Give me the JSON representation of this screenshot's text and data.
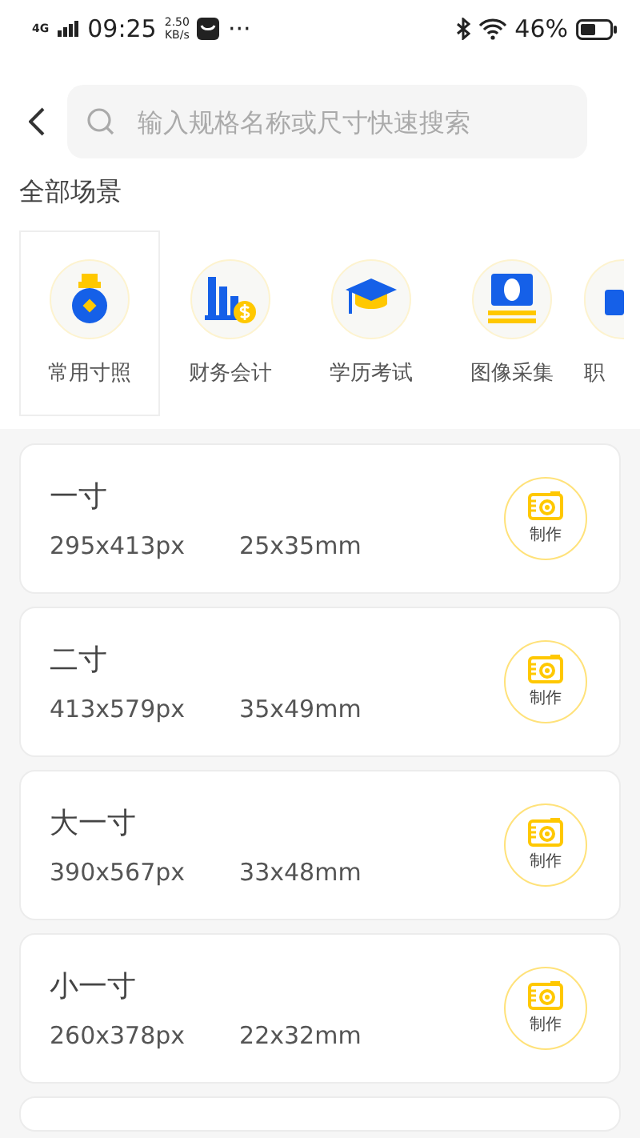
{
  "status_bar": {
    "network": "4G",
    "time": "09:25",
    "speed_value": "2.50",
    "speed_unit": "KB/s",
    "more": "···",
    "battery": "46%"
  },
  "search": {
    "placeholder": "输入规格名称或尺寸快速搜索"
  },
  "section_title": "全部场景",
  "categories": [
    {
      "label": "常用寸照",
      "kind": "medal",
      "selected": true
    },
    {
      "label": "财务会计",
      "kind": "finance",
      "selected": false
    },
    {
      "label": "学历考试",
      "kind": "graduation",
      "selected": false
    },
    {
      "label": "图像采集",
      "kind": "portrait",
      "selected": false
    },
    {
      "label": "职",
      "kind": "case",
      "selected": false
    }
  ],
  "specs": [
    {
      "title": "一寸",
      "pixels": "295x413px",
      "size": "25x35mm",
      "button": "制作"
    },
    {
      "title": "二寸",
      "pixels": "413x579px",
      "size": "35x49mm",
      "button": "制作"
    },
    {
      "title": "大一寸",
      "pixels": "390x567px",
      "size": "33x48mm",
      "button": "制作"
    },
    {
      "title": "小一寸",
      "pixels": "260x378px",
      "size": "22x32mm",
      "button": "制作"
    }
  ]
}
